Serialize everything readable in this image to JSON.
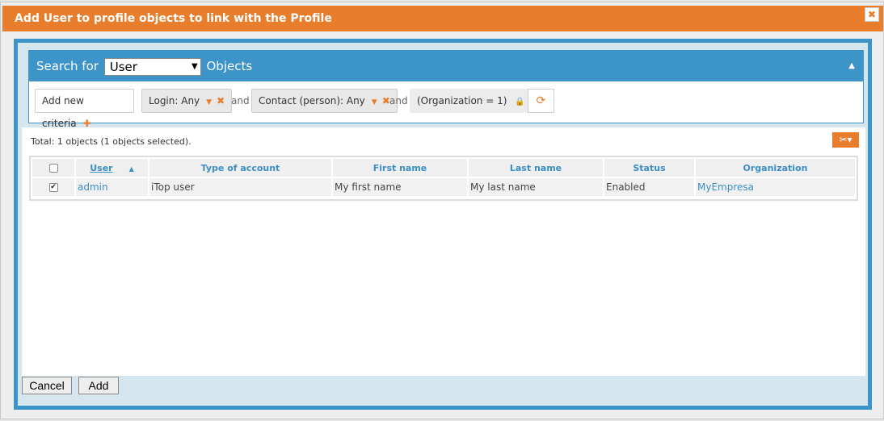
{
  "dialog": {
    "title": "Add User to profile objects to link with the Profile",
    "close_icon": "close-icon"
  },
  "search": {
    "prefix": "Search for",
    "class_value": "User",
    "suffix": "Objects",
    "add_criteria_label": "Add new criteria",
    "and_label": "and",
    "criteria": [
      {
        "label": "Login: Any"
      },
      {
        "label": "Contact (person): Any"
      }
    ],
    "locked_criteria": "(Organization = 1)"
  },
  "results": {
    "total_text": "Total: 1 objects (1 objects selected).",
    "columns": [
      "User",
      "Type of account",
      "First name",
      "Last name",
      "Status",
      "Organization"
    ],
    "rows": [
      {
        "checked": true,
        "user": "admin",
        "type_of_account": "iTop user",
        "first_name": "My first name",
        "last_name": "My last name",
        "status": "Enabled",
        "organization": "MyEmpresa"
      }
    ]
  },
  "buttons": {
    "cancel": "Cancel",
    "add": "Add"
  },
  "colors": {
    "accent_orange": "#e87d2c",
    "accent_blue": "#3c94c8"
  }
}
